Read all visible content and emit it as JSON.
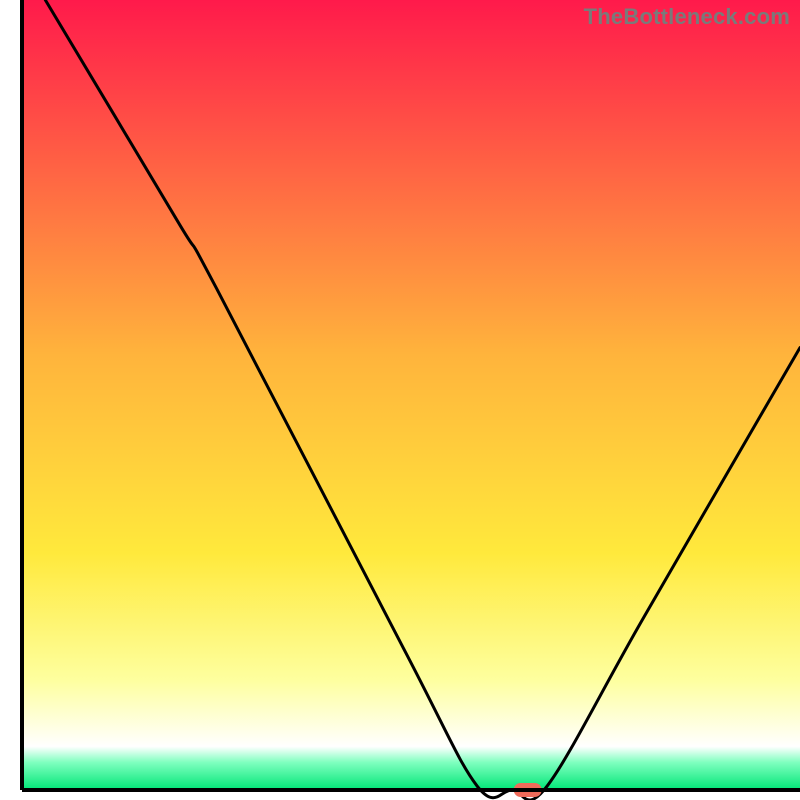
{
  "watermark": "TheBottleneck.com",
  "chart_data": {
    "type": "line",
    "title": "",
    "xlabel": "",
    "ylabel": "",
    "xlim": [
      0,
      100
    ],
    "ylim": [
      0,
      100
    ],
    "gradient_stops": [
      {
        "offset": 0.0,
        "color": "#ff1a4b"
      },
      {
        "offset": 0.45,
        "color": "#ffb43c"
      },
      {
        "offset": 0.7,
        "color": "#ffe93c"
      },
      {
        "offset": 0.86,
        "color": "#feff9e"
      },
      {
        "offset": 0.945,
        "color": "#ffffff"
      },
      {
        "offset": 0.965,
        "color": "#7fffbf"
      },
      {
        "offset": 1.0,
        "color": "#00e676"
      }
    ],
    "curve": [
      {
        "x": 3.0,
        "y": 100.0
      },
      {
        "x": 20.0,
        "y": 72.0
      },
      {
        "x": 25.0,
        "y": 63.5
      },
      {
        "x": 49.0,
        "y": 18.0
      },
      {
        "x": 58.5,
        "y": 0.5
      },
      {
        "x": 63.0,
        "y": 0.0
      },
      {
        "x": 67.5,
        "y": 0.5
      },
      {
        "x": 80.0,
        "y": 22.0
      },
      {
        "x": 100.0,
        "y": 56.0
      }
    ],
    "marker": {
      "x": 65.0,
      "y": 0.0
    },
    "marker_color": "#ef6b5a",
    "axis_color": "#000000"
  }
}
